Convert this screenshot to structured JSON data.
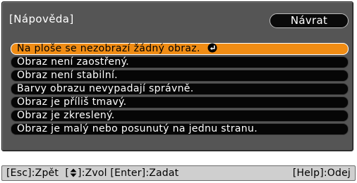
{
  "dialog": {
    "title": "[Nápověda]",
    "back_label": "Návrat",
    "items": [
      {
        "label": "Na ploše se nezobrazí žádný obraz.",
        "selected": true
      },
      {
        "label": "Obraz není zaostřený.",
        "selected": false
      },
      {
        "label": "Obraz není stabilní.",
        "selected": false
      },
      {
        "label": "Barvy obrazu nevypadají správně.",
        "selected": false
      },
      {
        "label": "Obraz je příliš tmavý.",
        "selected": false
      },
      {
        "label": "Obraz je zkreslený.",
        "selected": false
      },
      {
        "label": "Obraz je malý nebo posunutý na jednu stranu.",
        "selected": false
      }
    ]
  },
  "statusbar": {
    "esc": "[Esc]:Zpět",
    "nav_open": "[",
    "nav_close": "]:Zvol",
    "enter": "[Enter]:Zadat",
    "help": "[Help]:Odej"
  },
  "colors": {
    "panel": "#555555",
    "selected": "#f08c14",
    "item": "#060606",
    "statusbar": "#cfcfcf"
  },
  "icons": {
    "selected_item": "enter-icon",
    "navigation": "up-down-arrows-icon"
  }
}
